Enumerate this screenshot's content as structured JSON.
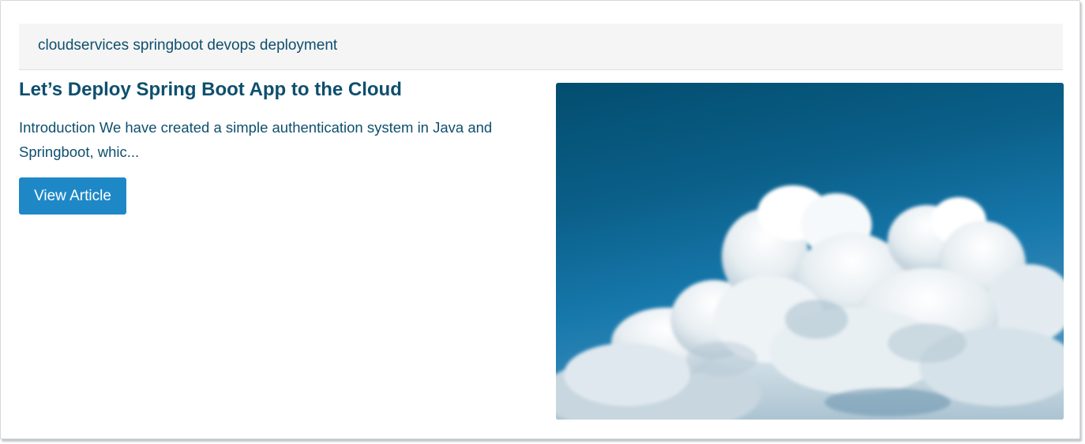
{
  "tags": {
    "text": "cloudservices springboot devops deployment"
  },
  "article": {
    "title": "Let’s Deploy Spring Boot App to the Cloud",
    "excerpt": "Introduction We have created a simple authentication system in Java and Springboot, whic...",
    "button_label": "View Article"
  },
  "image": {
    "description_icon": "cloud-image",
    "sky_top": "#045173",
    "sky_bottom": "#3f8fc0"
  },
  "colors": {
    "text": "#0e4f6e",
    "button": "#1e88c7",
    "tagbar": "#f5f5f5"
  }
}
